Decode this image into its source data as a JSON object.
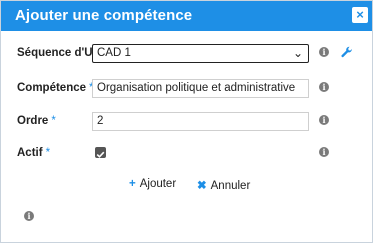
{
  "dialog": {
    "title": "Ajouter une compétence",
    "close_label": "×"
  },
  "form": {
    "sequence": {
      "label": "Séquence d'UV",
      "value": "CAD 1"
    },
    "competence": {
      "label": "Compétence",
      "required_mark": "*",
      "value": "Organisation politique et administrative"
    },
    "ordre": {
      "label": "Ordre",
      "required_mark": "*",
      "value": "2"
    },
    "actif": {
      "label": "Actif",
      "required_mark": "*",
      "checked": true
    }
  },
  "actions": {
    "add_icon": "+",
    "add_label": "Ajouter",
    "cancel_icon": "✖",
    "cancel_label": "Annuler"
  },
  "icons": {
    "info": "i",
    "accent_color": "#1e8fe6",
    "info_color": "#7a7a7a"
  }
}
